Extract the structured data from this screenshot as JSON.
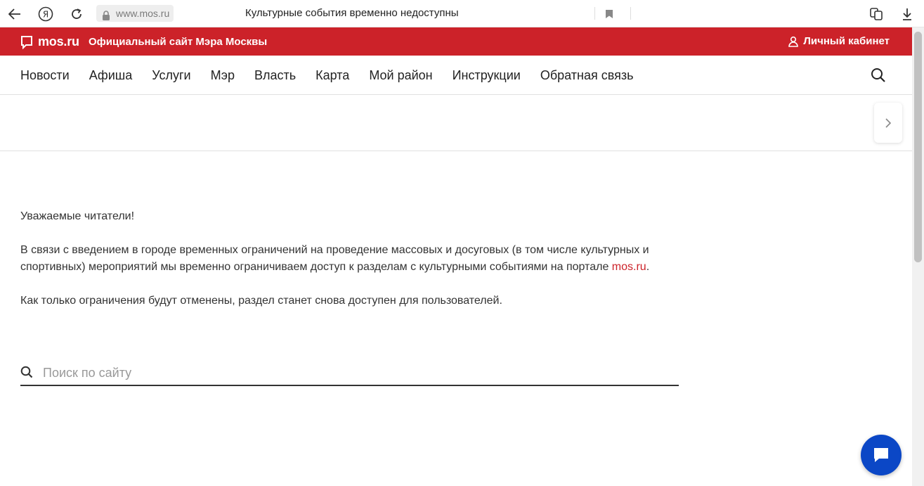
{
  "browser": {
    "url": "www.mos.ru",
    "tab_title": "Культурные события временно недоступны"
  },
  "header": {
    "logo_text": "mos.ru",
    "site_description": "Официальный сайт Мэра Москвы",
    "cabinet_label": "Личный кабинет",
    "brand_color": "#cc2229"
  },
  "nav": {
    "items": [
      {
        "label": "Новости"
      },
      {
        "label": "Афиша"
      },
      {
        "label": "Услуги"
      },
      {
        "label": "Мэр"
      },
      {
        "label": "Власть"
      },
      {
        "label": "Карта"
      },
      {
        "label": "Мой район"
      },
      {
        "label": "Инструкции"
      },
      {
        "label": "Обратная связь"
      }
    ]
  },
  "content": {
    "greeting": "Уважаемые читатели!",
    "paragraph1": "В связи с введением в городе временных ограничений на проведение массовых и досуговых (в том числе культурных и спортивных) мероприятий мы временно ограничиваем доступ к разделам с культурными событиями на портале ",
    "paragraph1_link": "mos.ru",
    "paragraph1_end": ".",
    "paragraph2": "Как только ограничения будут отменены, раздел станет снова доступен для пользователей."
  },
  "search": {
    "placeholder": "Поиск по сайту"
  },
  "chat": {
    "color": "#0b47c6"
  }
}
